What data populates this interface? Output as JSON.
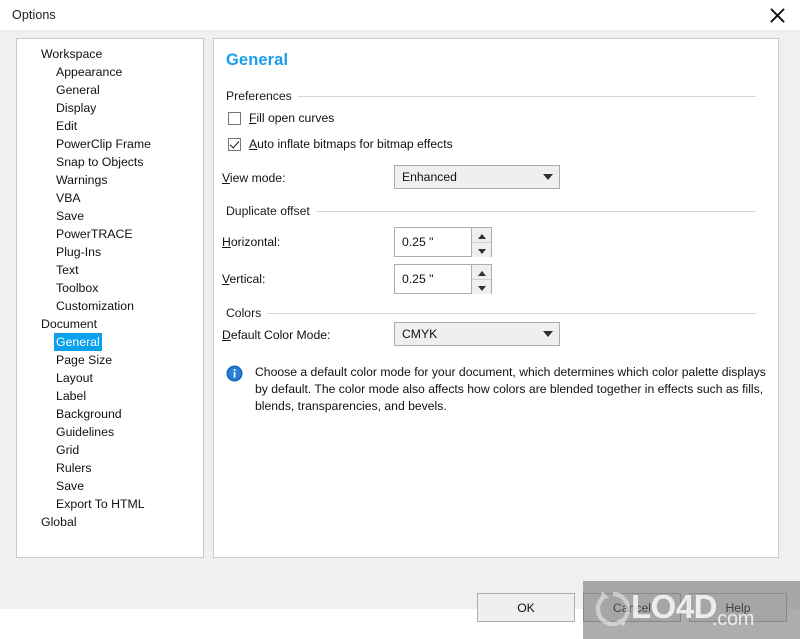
{
  "window": {
    "title": "Options",
    "close_icon": "close-icon"
  },
  "tree": {
    "items": [
      {
        "label": "Workspace",
        "level": 0,
        "marker": "expanded",
        "selected": false
      },
      {
        "label": "Appearance",
        "level": 1,
        "marker": "none",
        "selected": false
      },
      {
        "label": "General",
        "level": 1,
        "marker": "none",
        "selected": false
      },
      {
        "label": "Display",
        "level": 1,
        "marker": "none",
        "selected": false
      },
      {
        "label": "Edit",
        "level": 1,
        "marker": "none",
        "selected": false
      },
      {
        "label": "PowerClip Frame",
        "level": 1,
        "marker": "none",
        "selected": false
      },
      {
        "label": "Snap to Objects",
        "level": 1,
        "marker": "none",
        "selected": false
      },
      {
        "label": "Warnings",
        "level": 1,
        "marker": "none",
        "selected": false
      },
      {
        "label": "VBA",
        "level": 1,
        "marker": "none",
        "selected": false
      },
      {
        "label": "Save",
        "level": 1,
        "marker": "none",
        "selected": false
      },
      {
        "label": "PowerTRACE",
        "level": 1,
        "marker": "none",
        "selected": false
      },
      {
        "label": "Plug-Ins",
        "level": 1,
        "marker": "none",
        "selected": false
      },
      {
        "label": "Text",
        "level": 1,
        "marker": "collapsed",
        "selected": false
      },
      {
        "label": "Toolbox",
        "level": 1,
        "marker": "collapsed",
        "selected": false
      },
      {
        "label": "Customization",
        "level": 1,
        "marker": "collapsed",
        "selected": false
      },
      {
        "label": "Document",
        "level": 0,
        "marker": "expanded",
        "selected": false
      },
      {
        "label": "General",
        "level": 1,
        "marker": "none",
        "selected": true
      },
      {
        "label": "Page Size",
        "level": 1,
        "marker": "none",
        "selected": false
      },
      {
        "label": "Layout",
        "level": 1,
        "marker": "none",
        "selected": false
      },
      {
        "label": "Label",
        "level": 1,
        "marker": "none",
        "selected": false
      },
      {
        "label": "Background",
        "level": 1,
        "marker": "none",
        "selected": false
      },
      {
        "label": "Guidelines",
        "level": 1,
        "marker": "collapsed",
        "selected": false
      },
      {
        "label": "Grid",
        "level": 1,
        "marker": "none",
        "selected": false
      },
      {
        "label": "Rulers",
        "level": 1,
        "marker": "none",
        "selected": false
      },
      {
        "label": "Save",
        "level": 1,
        "marker": "none",
        "selected": false
      },
      {
        "label": "Export To HTML",
        "level": 1,
        "marker": "none",
        "selected": false
      },
      {
        "label": "Global",
        "level": 0,
        "marker": "collapsed",
        "selected": false
      }
    ]
  },
  "content": {
    "page_title": "General",
    "accent_color": "#1a9eea",
    "groups": {
      "preferences": "Preferences",
      "duplicate_offset": "Duplicate offset",
      "colors": "Colors"
    },
    "fill_open_curves": {
      "label_prefix": "",
      "label_accel": "F",
      "label_rest": "ill open curves",
      "checked": false
    },
    "auto_inflate": {
      "label_accel": "A",
      "label_rest": "uto inflate bitmaps for bitmap effects",
      "checked": true
    },
    "view_mode": {
      "label_accel": "V",
      "label_rest": "iew mode:",
      "value": "Enhanced"
    },
    "horizontal": {
      "label_accel": "H",
      "label_rest": "orizontal:",
      "value": "0.25 \""
    },
    "vertical": {
      "label_accel": "V",
      "label_rest": "ertical:",
      "value": "0.25 \""
    },
    "default_color_mode": {
      "label_accel": "D",
      "label_rest": "efault Color Mode:",
      "value": "CMYK"
    },
    "info": {
      "icon": "info-icon",
      "text": "Choose a default color mode for your document, which determines which color palette displays by default. The color mode also affects how colors are blended together in effects such as fills, blends, transparencies, and bevels."
    }
  },
  "footer": {
    "ok": "OK",
    "cancel": "Cancel",
    "help": "Help"
  },
  "watermark": {
    "brand": "LO4D",
    "domain": ".com"
  }
}
